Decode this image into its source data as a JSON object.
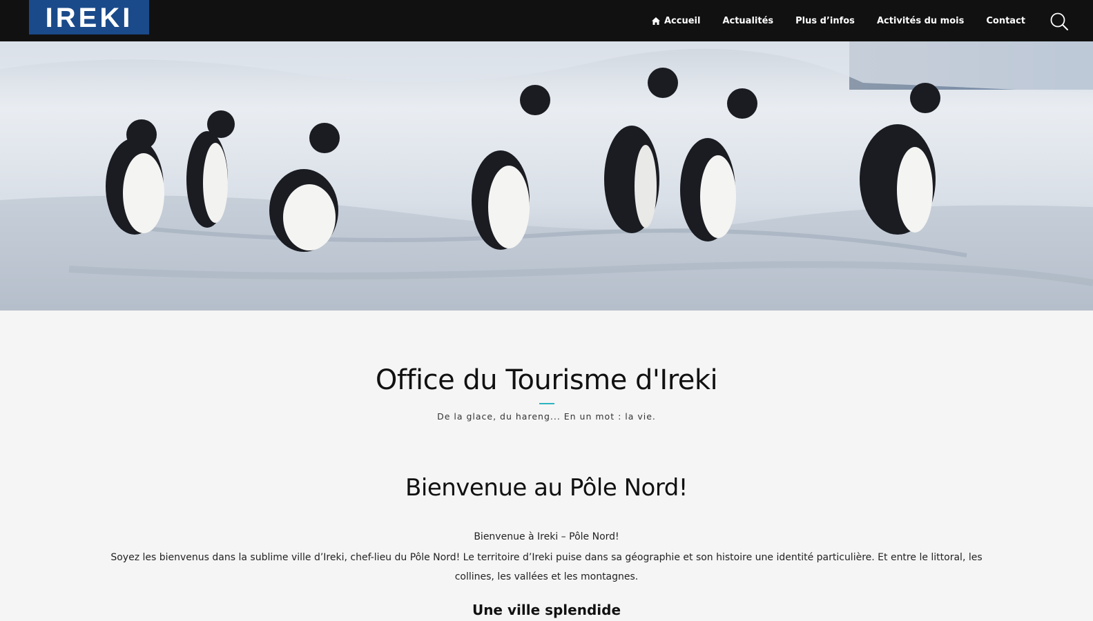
{
  "header": {
    "logo_text": "IREKI",
    "nav": [
      {
        "label": "Accueil",
        "icon": "home-icon"
      },
      {
        "label": "Actualités"
      },
      {
        "label": "Plus d’infos"
      },
      {
        "label": "Activités du mois"
      },
      {
        "label": "Contact"
      }
    ],
    "search_icon": "search-icon"
  },
  "hero": {
    "image": "penguins-on-ice"
  },
  "main": {
    "title": "Office du Tourisme d'Ireki",
    "tagline": "De la glace, du hareng... En un mot : la vie.",
    "welcome_heading": "Bienvenue au Pôle Nord!",
    "intro_line": "Bienvenue à Ireki – Pôle Nord!",
    "paragraph": "Soyez les bienvenus dans la sublime ville d’Ireki, chef-lieu du Pôle Nord! Le territoire d’Ireki puise dans sa géographie et son histoire une identité particulière. Et entre le littoral, les collines, les vallées et les montagnes.",
    "subheading": "Une ville splendide"
  },
  "colors": {
    "header_bg": "#111111",
    "logo_bg": "#1a4a8a",
    "accent": "#2bb3c0",
    "page_bg": "#f5f5f5"
  }
}
